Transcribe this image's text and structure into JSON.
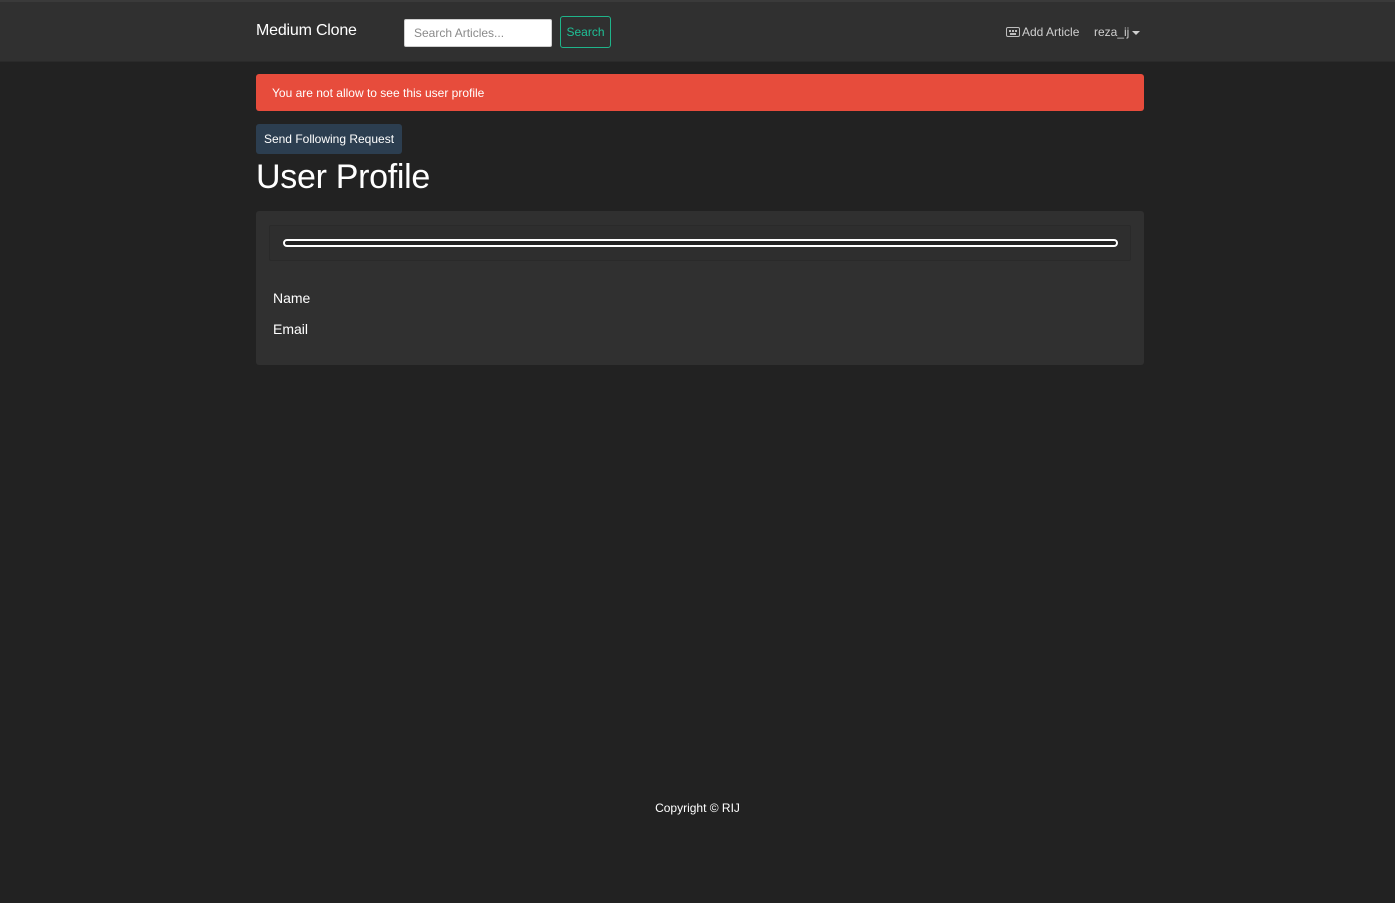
{
  "navbar": {
    "brand": "Medium Clone",
    "search_placeholder": "Search Articles...",
    "search_label": "Search",
    "add_article_label": "Add Article",
    "username": "reza_ij"
  },
  "alert": {
    "message": "You are not allow to see this user profile",
    "color": "#e74c3c"
  },
  "actions": {
    "follow_label": "Send Following Request"
  },
  "profile": {
    "title": "User Profile",
    "progress_percent": 0,
    "name_label": "Name",
    "email_label": "Email"
  },
  "footer": {
    "copyright": "Copyright © RIJ"
  },
  "colors": {
    "background": "#222222",
    "navbar": "#303030",
    "accent": "#1fc096",
    "primary_button": "#2c3e50"
  }
}
